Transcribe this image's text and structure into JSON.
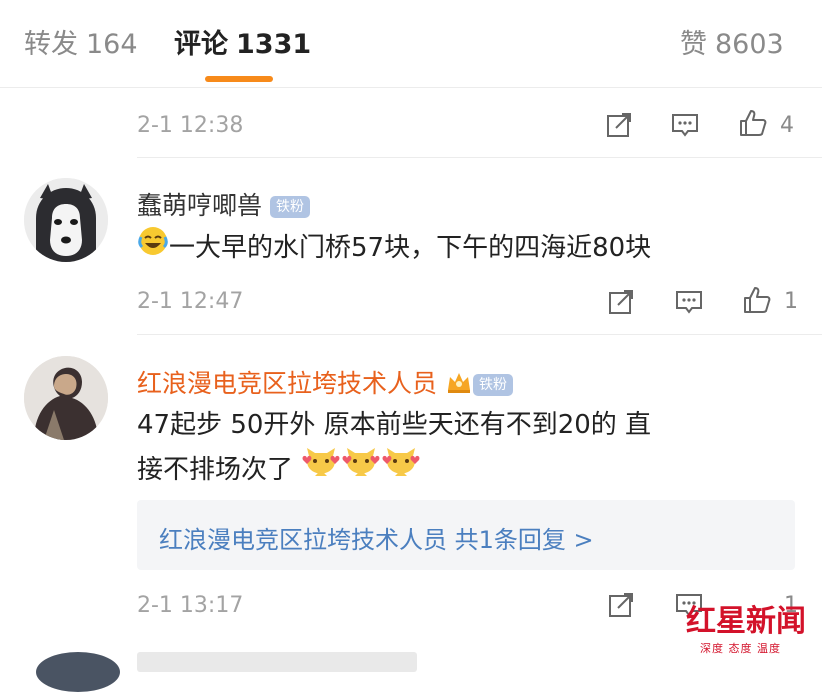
{
  "tabs": {
    "repost": {
      "label": "转发",
      "count": "164"
    },
    "comment": {
      "label": "评论",
      "count": "1331"
    },
    "like": {
      "label": "赞",
      "count": "8603"
    },
    "accent_color": "#f78a1a"
  },
  "comments": [
    {
      "time": "2-1 12:38",
      "like_count": "4"
    },
    {
      "user": "蠢萌哼唧兽",
      "badge": "铁粉",
      "text": "一大早的水门桥57块，下午的四海近80块",
      "emoji_prefix": "laughing-tears",
      "time": "2-1 12:47",
      "like_count": "1"
    },
    {
      "user": "红浪漫电竞区拉垮技术人员",
      "badge": "铁粉",
      "line1": "47起步  50开外  原本前些天还有不到20的 直",
      "line2": "接不排场次了",
      "emoji_suffix": [
        "cat-heart",
        "cat-heart",
        "cat-heart"
      ],
      "reply_summary": "红浪漫电竞区拉垮技术人员  共1条回复 >",
      "time": "2-1 13:17",
      "like_count": "1"
    }
  ],
  "watermark": {
    "main": "红星新闻",
    "sub": "深度 态度 温度"
  },
  "colors": {
    "name_orange": "#e8611d",
    "name_dark": "#333333",
    "link_blue": "#4b7fbf",
    "badge_blue": "#b0c4e3",
    "watermark_red": "#d3122a"
  }
}
